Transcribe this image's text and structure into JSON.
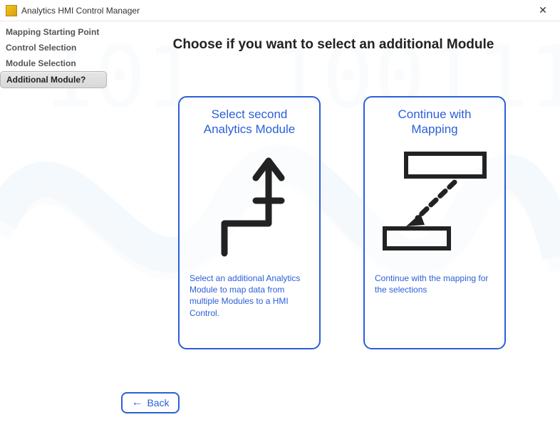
{
  "titlebar": {
    "title": "Analytics HMI Control Manager"
  },
  "sidebar": {
    "steps": [
      {
        "label": "Mapping Starting Point",
        "active": false
      },
      {
        "label": "Control Selection",
        "active": false
      },
      {
        "label": "Module Selection",
        "active": false
      },
      {
        "label": "Additional Module?",
        "active": true
      }
    ]
  },
  "heading": "Choose if you want to select an additional Module",
  "cards": [
    {
      "id": "select-second-module",
      "title": "Select second Analytics Module",
      "description": "Select an additional Analytics Module to map data from multiple Modules to a HMI Control.",
      "graphic": "branch-arrow"
    },
    {
      "id": "continue-mapping",
      "title": "Continue with Mapping",
      "description": "Continue with the mapping for the selections",
      "graphic": "box-to-box-arrow"
    }
  ],
  "buttons": {
    "back_label": "Back"
  }
}
